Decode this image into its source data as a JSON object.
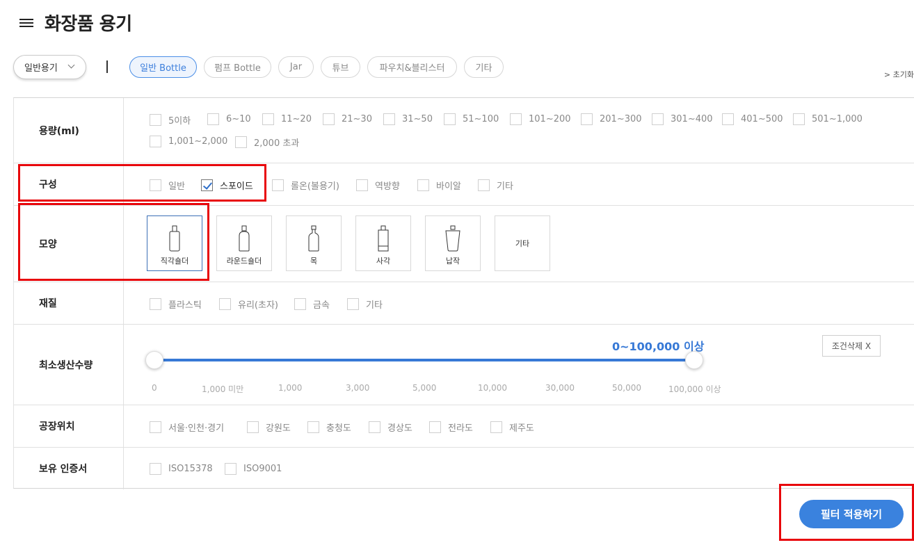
{
  "header": {
    "title": "화장품 용기"
  },
  "filterbar": {
    "select_label": "일반용기",
    "chips": [
      "일반 Bottle",
      "펌프 Bottle",
      "Jar",
      "튜브",
      "파우치&블리스터",
      "기타"
    ],
    "active_chip": "일반 Bottle",
    "reset_label": "> 초기화"
  },
  "rows": {
    "capacity": {
      "label": "용량(ml)",
      "options": [
        "5이하",
        "6~10",
        "11~20",
        "21~30",
        "31~50",
        "51~100",
        "101~200",
        "201~300",
        "301~400",
        "401~500",
        "501~1,000",
        "1,001~2,000",
        "2,000 초과"
      ]
    },
    "composition": {
      "label": "구성",
      "options": [
        "일반",
        "스포이드",
        "롤온(볼용기)",
        "역방향",
        "바이알",
        "기타"
      ],
      "checked": "스포이드"
    },
    "shape": {
      "label": "모양",
      "options": [
        "직각숄더",
        "라운드숄더",
        "목",
        "사각",
        "납작",
        "기타"
      ],
      "selected": "직각숄더"
    },
    "material": {
      "label": "재질",
      "options": [
        "플라스틱",
        "유리(초자)",
        "금속",
        "기타"
      ]
    },
    "moq": {
      "label": "최소생산수량",
      "value_text": "0~100,000 이상",
      "range": [
        0,
        100000
      ],
      "ticks": [
        "0",
        "1,000 미만",
        "1,000",
        "3,000",
        "5,000",
        "10,000",
        "30,000",
        "50,000",
        "100,000 이상"
      ],
      "clear_label": "조건삭제 X"
    },
    "factory": {
      "label": "공장위치",
      "options": [
        "서울·인천·경기",
        "강원도",
        "충청도",
        "경상도",
        "전라도",
        "제주도"
      ]
    },
    "cert": {
      "label": "보유 인증서",
      "options": [
        "ISO15378",
        "ISO9001"
      ]
    }
  },
  "apply_label": "필터 적용하기",
  "colors": {
    "accent": "#3a82de",
    "highlight": "#e8060b"
  }
}
